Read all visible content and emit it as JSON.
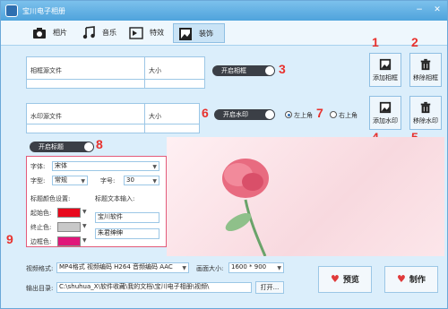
{
  "window": {
    "title": "宝川电子相册",
    "minimize": "−",
    "close": "✕"
  },
  "tabs": [
    {
      "label": "相片",
      "icon": "camera-icon"
    },
    {
      "label": "音乐",
      "icon": "music-note-icon"
    },
    {
      "label": "特效",
      "icon": "effects-icon"
    },
    {
      "label": "装饰",
      "icon": "picture-icon"
    }
  ],
  "markers": [
    "1",
    "2",
    "3",
    "4",
    "5",
    "6",
    "7",
    "8",
    "9"
  ],
  "frame": {
    "col_file": "相框源文件",
    "col_size": "大小",
    "toggle": "开启相框",
    "add": "添加相框",
    "remove": "移除相框"
  },
  "watermark": {
    "col_file": "水印源文件",
    "col_size": "大小",
    "toggle": "开启水印",
    "pos_left": "左上角",
    "pos_right": "右上角",
    "add": "添加水印",
    "remove": "移除水印"
  },
  "caption": {
    "toggle": "开启标题",
    "font_label": "字体:",
    "font_value": "宋体",
    "style_label": "字型:",
    "style_value": "常规",
    "size_label": "字号:",
    "size_value": "30",
    "color_section": "标题颜色设置:",
    "start_label": "起始色:",
    "start_color": "#e8081c",
    "end_label": "终止色:",
    "end_color": "#c8c8c8",
    "border_label": "边框色:",
    "border_color": "#e0167a",
    "text_section": "标题文本输入:",
    "text1": "宝川软件",
    "text2": "朱君绅绅"
  },
  "bottom": {
    "format_label": "视频格式:",
    "format_value": "MP4格式  视频编码 H264 音频编码 AAC",
    "size_label": "画面大小:",
    "size_value": "1600 * 900",
    "out_label": "输出目录:",
    "out_value": "C:\\shuhua_X\\软件收藏\\我的文档\\宝川电子相册\\视频\\",
    "open_btn": "打开...",
    "preview_btn": "预览",
    "make_btn": "制作"
  }
}
